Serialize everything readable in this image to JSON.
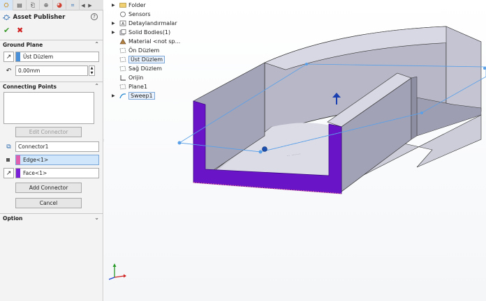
{
  "panel": {
    "title": "Asset Publisher",
    "help": "?",
    "ok_symbol": "✔",
    "cancel_symbol": "✖",
    "ground_plane": {
      "header": "Ground Plane",
      "plane_value": "Üst Düzlem",
      "offset_value": "0.00mm"
    },
    "connecting_points": {
      "header": "Connecting Points",
      "edit_connector_label": "Edit Connector",
      "connector_name": "Connector1",
      "edge_value": "Edge<1>",
      "face_value": "Face<1>",
      "add_connector_label": "Add Connector",
      "cancel_label": "Cancel"
    },
    "option": {
      "header": "Option"
    }
  },
  "tree": {
    "items": [
      {
        "label": "Folder",
        "expandable": true,
        "icon": "folder-icon"
      },
      {
        "label": "Sensors",
        "expandable": false,
        "icon": "sensor-icon"
      },
      {
        "label": "Detaylandırmalar",
        "expandable": true,
        "icon": "annotations-icon"
      },
      {
        "label": "Solid Bodies(1)",
        "expandable": true,
        "icon": "solid-bodies-icon"
      },
      {
        "label": "Material <not sp...",
        "expandable": false,
        "icon": "material-icon"
      },
      {
        "label": "Ön Düzlem",
        "expandable": false,
        "icon": "plane-icon"
      },
      {
        "label": "Üst Düzlem",
        "expandable": false,
        "icon": "plane-icon",
        "highlighted": true
      },
      {
        "label": "Sağ Düzlem",
        "expandable": false,
        "icon": "plane-icon"
      },
      {
        "label": "Orijin",
        "expandable": false,
        "icon": "origin-icon"
      },
      {
        "label": "Plane1",
        "expandable": false,
        "icon": "plane-icon"
      },
      {
        "label": "Sweep1",
        "expandable": true,
        "icon": "sweep-icon",
        "highlighted": true
      }
    ]
  },
  "colors": {
    "accent_blue": "#1e6fd0",
    "plane_swatch": "#4a90d9",
    "edge_swatch": "#e060b0",
    "face_swatch": "#7a1fd8",
    "selection_purple": "#6a14c8",
    "model_gray": "#a9a9bd"
  }
}
